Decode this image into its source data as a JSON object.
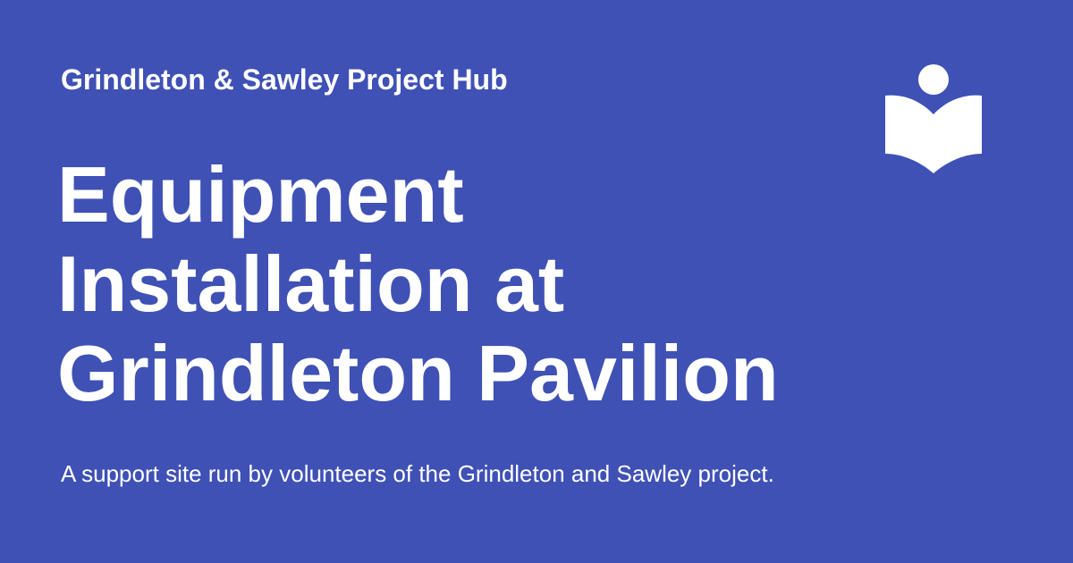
{
  "site": {
    "name": "Grindleton & Sawley Project Hub"
  },
  "page": {
    "title": "Equipment Installation at Grindleton Pavilion",
    "tagline": "A support site run by volunteers of the Grindleton and Sawley project."
  },
  "logo": {
    "icon": "person-reading-book-icon"
  },
  "colors": {
    "background": "#3f51b5",
    "text": "#ffffff"
  }
}
